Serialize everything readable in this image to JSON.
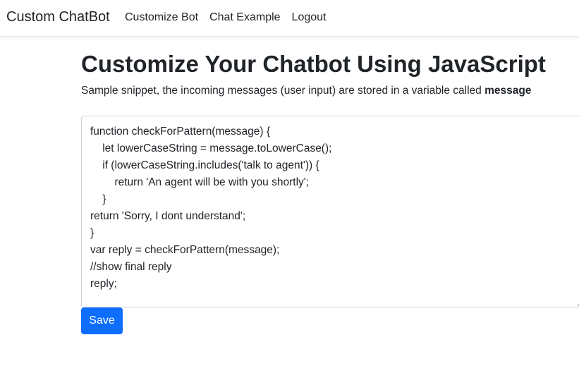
{
  "navbar": {
    "brand": "Custom ChatBot",
    "links": [
      "Customize Bot",
      "Chat Example",
      "Logout"
    ]
  },
  "main": {
    "title": "Customize Your Chatbot Using JavaScript",
    "description_prefix": "Sample snippet, the incoming messages (user input) are stored in a variable called ",
    "description_variable": "message",
    "code": "function checkForPattern(message) {\n    let lowerCaseString = message.toLowerCase();\n    if (lowerCaseString.includes('talk to agent')) {\n        return 'An agent will be with you shortly';\n    }\nreturn 'Sorry, I dont understand';\n}\nvar reply = checkForPattern(message);\n//show final reply\nreply;",
    "save_label": "Save"
  },
  "colors": {
    "primary": "#0d6efd",
    "text": "#212529",
    "border": "#ced4da"
  }
}
